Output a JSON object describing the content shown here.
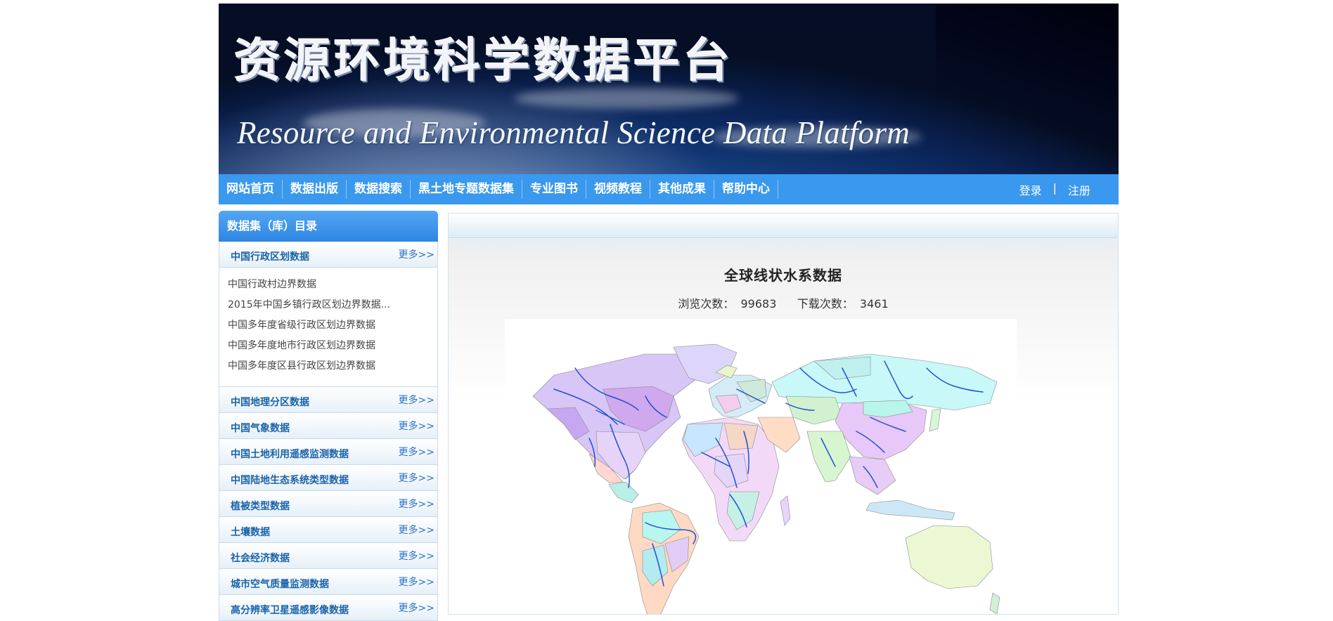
{
  "banner": {
    "title_cn": "资源环境科学数据平台",
    "title_en": "Resource and Environmental Science Data Platform"
  },
  "nav": {
    "items": [
      "网站首页",
      "数据出版",
      "数据搜索",
      "黑土地专题数据集",
      "专业图书",
      "视频教程",
      "其他成果",
      "帮助中心"
    ],
    "login": "登录",
    "separator": "|",
    "register": "注册"
  },
  "sidebar": {
    "title": "数据集（库）目录",
    "more_label": "更多>>",
    "first_category": {
      "label": "中国行政区划数据",
      "items": [
        "中国行政村边界数据",
        "2015年中国乡镇行政区划边界数据...",
        "中国多年度省级行政区划边界数据",
        "中国多年度地市行政区划边界数据",
        "中国多年度区县行政区划边界数据"
      ]
    },
    "categories": [
      "中国地理分区数据",
      "中国气象数据",
      "中国土地利用遥感监测数据",
      "中国陆地生态系统类型数据",
      "植被类型数据",
      "土壤数据",
      "社会经济数据",
      "城市空气质量监测数据",
      "高分辨率卫星遥感影像数据"
    ]
  },
  "content": {
    "title": "全球线状水系数据",
    "views_label": "浏览次数：",
    "views": "99683",
    "downloads_label": "下载次数：",
    "downloads": "3461"
  },
  "colors": {
    "nav_blue": "#3a98ee",
    "link_blue": "#1a63a8",
    "river_blue": "#1f4fd6"
  }
}
